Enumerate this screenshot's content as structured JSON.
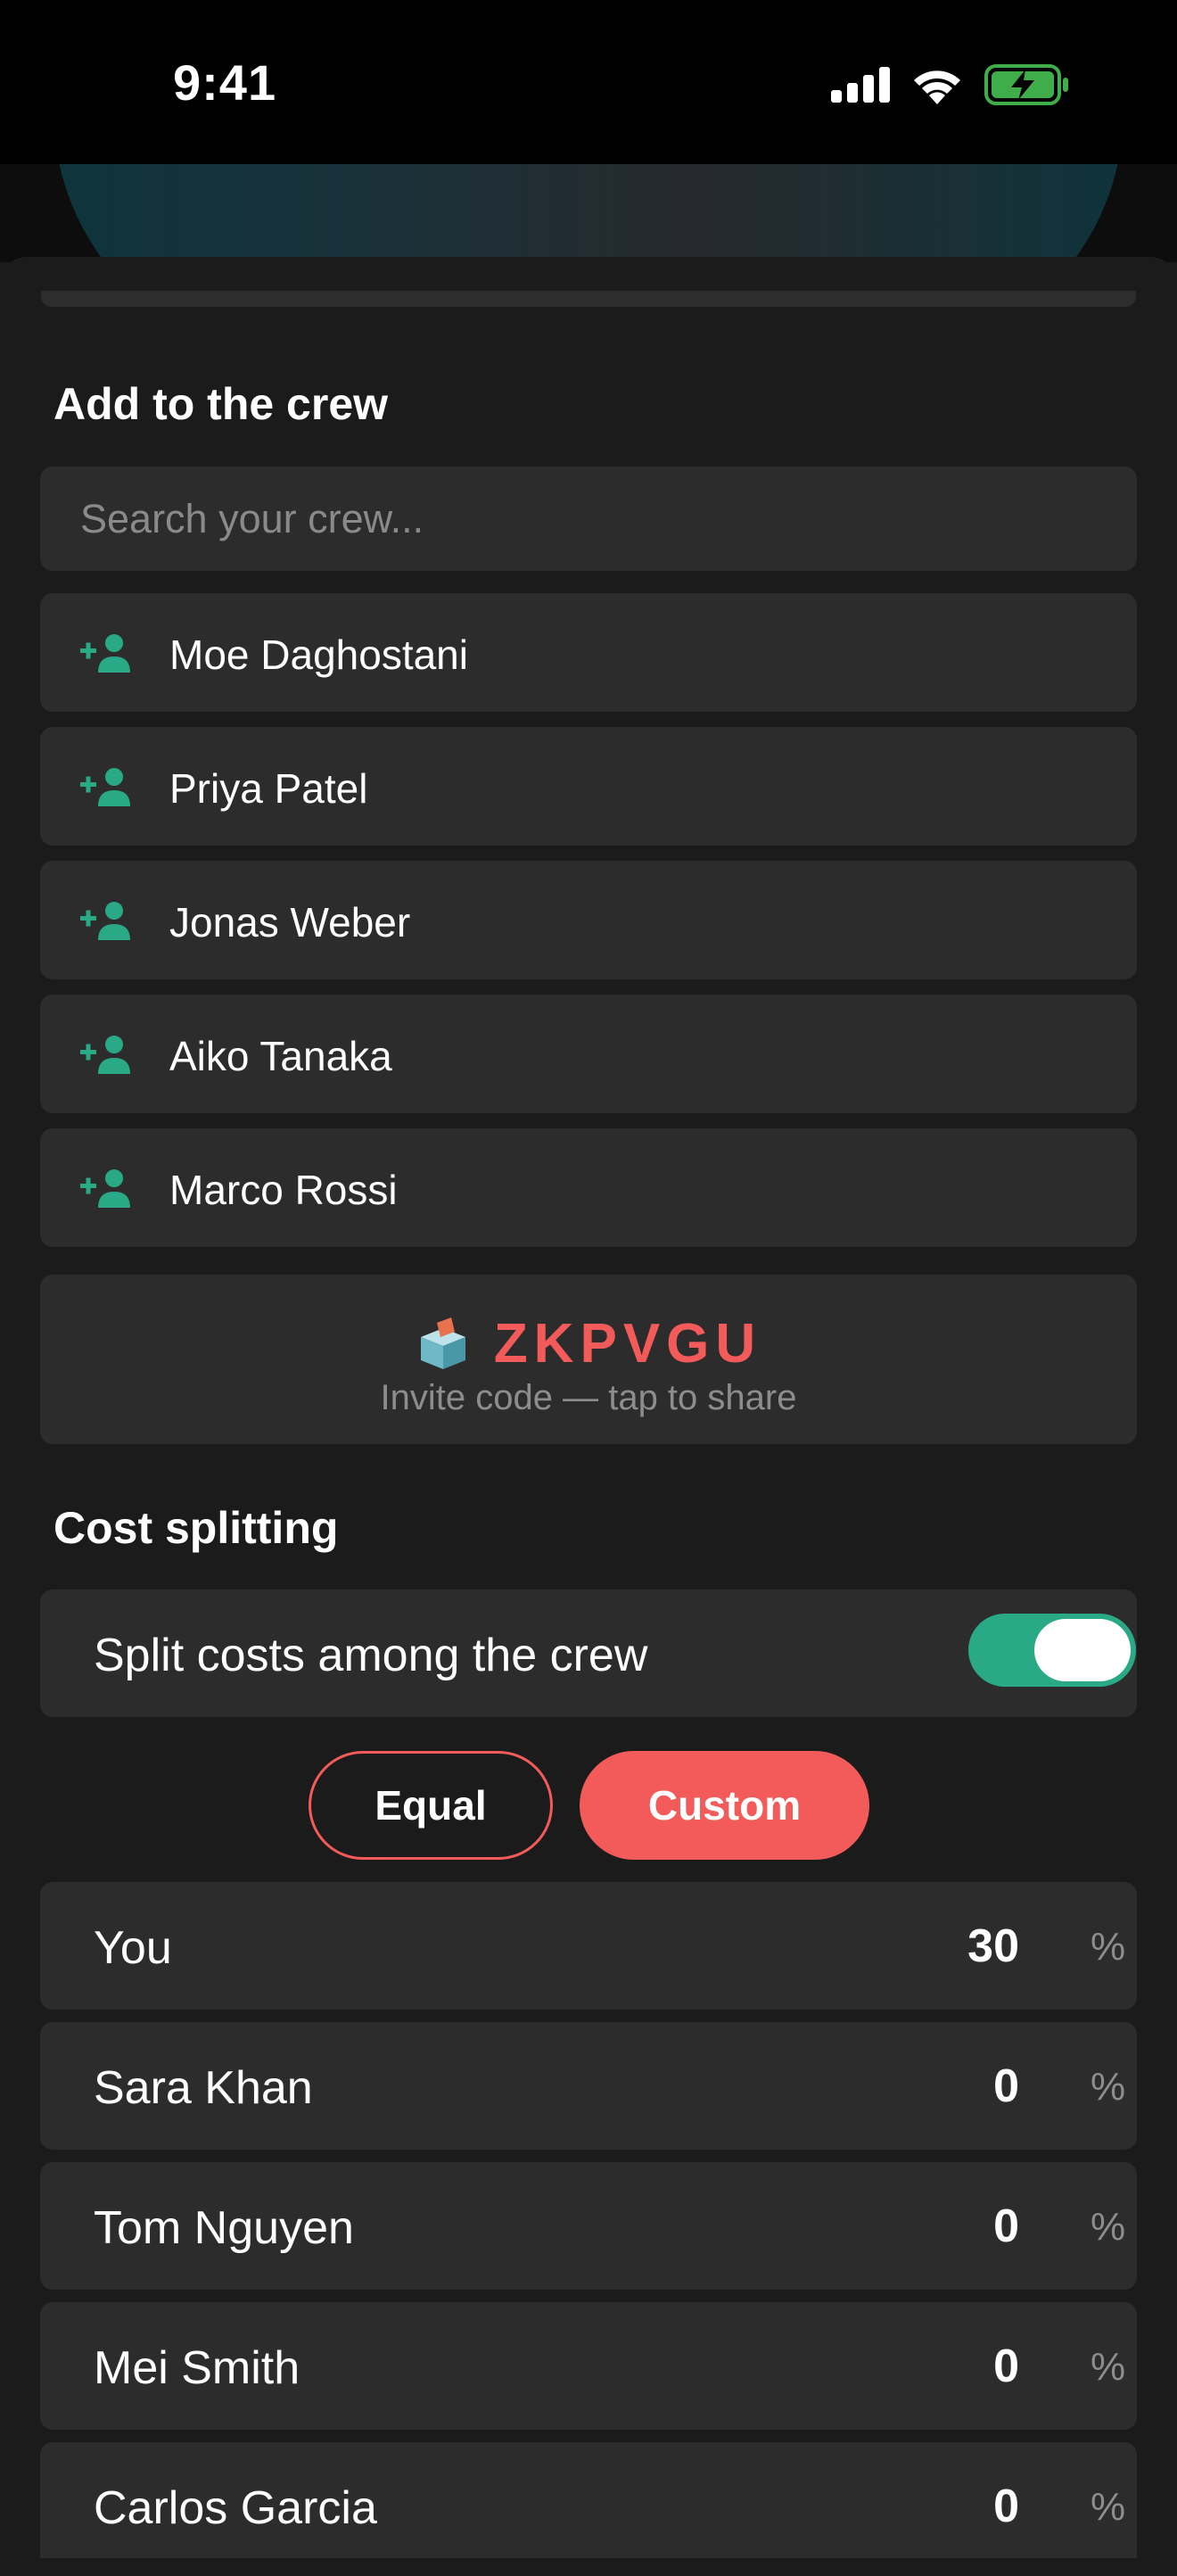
{
  "status_bar": {
    "time": "9:41",
    "icons": [
      "cellular-signal-icon",
      "wifi-icon",
      "battery-charging-icon"
    ]
  },
  "colors": {
    "accent_green": "#2aa987",
    "accent_red": "#f25b59",
    "card_bg": "#2c2c2c",
    "sheet_bg": "#1b1b1b"
  },
  "add_crew": {
    "title": "Add to the crew",
    "search_placeholder": "Search your crew...",
    "members": [
      {
        "name": "Moe Daghostani",
        "icon": "add-person-icon"
      },
      {
        "name": "Priya Patel",
        "icon": "add-person-icon"
      },
      {
        "name": "Jonas Weber",
        "icon": "add-person-icon"
      },
      {
        "name": "Aiko Tanaka",
        "icon": "add-person-icon"
      },
      {
        "name": "Marco Rossi",
        "icon": "add-person-icon"
      }
    ]
  },
  "invite": {
    "emoji": "🗳️",
    "code": "ZKPVGU",
    "caption": "Invite code — tap to share"
  },
  "cost_splitting": {
    "title": "Cost splitting",
    "toggle_label": "Split costs among the crew",
    "toggle_on": true,
    "modes": {
      "equal": "Equal",
      "custom": "Custom",
      "selected": "custom"
    },
    "unit": "%",
    "shares": [
      {
        "name": "You",
        "value": "30"
      },
      {
        "name": "Sara Khan",
        "value": "0"
      },
      {
        "name": "Tom Nguyen",
        "value": "0"
      },
      {
        "name": "Mei Smith",
        "value": "0"
      },
      {
        "name": "Carlos Garcia",
        "value": "0"
      }
    ]
  }
}
